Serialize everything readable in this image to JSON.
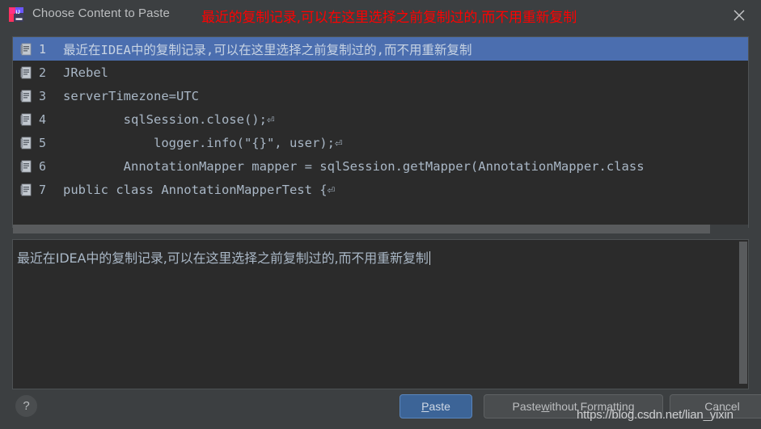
{
  "window": {
    "title": "Choose Content to Paste",
    "app_icon": "intellij-idea-icon",
    "close_icon": "close-icon"
  },
  "annotation": {
    "top_note": "最近的复制记录,可以在这里选择之前复制过的,而不用重新复制",
    "color": "#ff0000"
  },
  "clipboard_list": {
    "selected_index": 0,
    "item_icon": "clipboard-entry-icon",
    "items": [
      {
        "num": "1",
        "text": "最近在IDEA中的复制记录,可以在这里选择之前复制过的,而不用重新复制"
      },
      {
        "num": "2",
        "text": "JRebel"
      },
      {
        "num": "3",
        "text": "serverTimezone=UTC"
      },
      {
        "num": "4",
        "text": "        sqlSession.close();⏎"
      },
      {
        "num": "5",
        "text": "            logger.info(\"{}\", user);⏎"
      },
      {
        "num": "6",
        "text": "        AnnotationMapper mapper = sqlSession.getMapper(AnnotationMapper.class"
      },
      {
        "num": "7",
        "text": "public class AnnotationMapperTest {⏎"
      }
    ]
  },
  "preview": {
    "text": "最近在IDEA中的复制记录,可以在这里选择之前复制过的,而不用重新复制"
  },
  "footer": {
    "help_label": "?",
    "paste_label_before": "",
    "paste_mnemonic": "P",
    "paste_label_after": "aste",
    "pwf_label_before": "Paste ",
    "pwf_mnemonic": "w",
    "pwf_label_after": "ithout Formatting",
    "cancel_label": "Cancel"
  },
  "watermark": {
    "text": "https://blog.csdn.net/lian_yixin"
  },
  "colors": {
    "dialog_bg": "#3c3f41",
    "panel_bg": "#2b2b2b",
    "selection": "#4b6eaf",
    "text": "#a9b7c6",
    "accent_button": "#3c6497"
  }
}
